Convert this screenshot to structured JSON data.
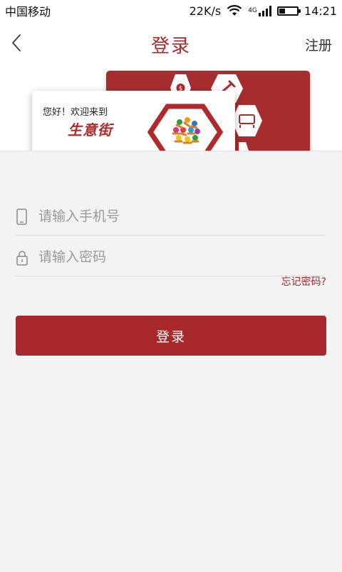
{
  "status_bar": {
    "carrier": "中国移动",
    "speed": "22K/s",
    "network_type": "4G",
    "battery_level": 0.35,
    "time": "14:21"
  },
  "nav": {
    "title": "登录",
    "register": "注册",
    "back_icon": "chevron-left-icon"
  },
  "banner": {
    "welcome": "您好！欢迎来到",
    "brand": "生意街",
    "icons": [
      "dollar-icon",
      "wrench-icon",
      "sofa-icon",
      "people-logo-icon"
    ]
  },
  "form": {
    "phone_placeholder": "请输入手机号",
    "password_placeholder": "请输入密码",
    "forgot_password": "忘记密码?",
    "login_button": "登录"
  },
  "colors": {
    "accent": "#a8282b",
    "form_background": "#f3f3f3"
  }
}
